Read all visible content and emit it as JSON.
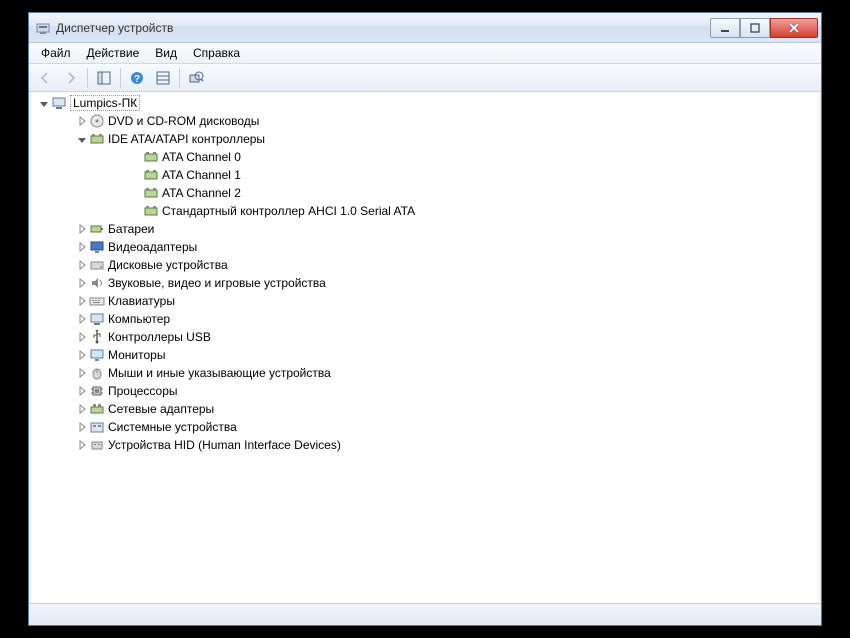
{
  "window": {
    "title": "Диспетчер устройств"
  },
  "menu": {
    "file": "Файл",
    "action": "Действие",
    "view": "Вид",
    "help": "Справка"
  },
  "tree": {
    "root": "Lumpics-ПК",
    "items": [
      {
        "label": "DVD и CD-ROM дисководы",
        "icon": "disc",
        "expanded": false,
        "children": []
      },
      {
        "label": "IDE ATA/ATAPI контроллеры",
        "icon": "controller",
        "expanded": true,
        "children": [
          {
            "label": "ATA Channel 0",
            "icon": "controller"
          },
          {
            "label": "ATA Channel 1",
            "icon": "controller"
          },
          {
            "label": "ATA Channel 2",
            "icon": "controller"
          },
          {
            "label": "Стандартный контроллер AHCI 1.0 Serial ATA",
            "icon": "controller"
          }
        ]
      },
      {
        "label": "Батареи",
        "icon": "battery",
        "expanded": false,
        "children": []
      },
      {
        "label": "Видеоадаптеры",
        "icon": "display",
        "expanded": false,
        "children": []
      },
      {
        "label": "Дисковые устройства",
        "icon": "drive",
        "expanded": false,
        "children": []
      },
      {
        "label": "Звуковые, видео и игровые устройства",
        "icon": "sound",
        "expanded": false,
        "children": []
      },
      {
        "label": "Клавиатуры",
        "icon": "keyboard",
        "expanded": false,
        "children": []
      },
      {
        "label": "Компьютер",
        "icon": "computer",
        "expanded": false,
        "children": []
      },
      {
        "label": "Контроллеры USB",
        "icon": "usb",
        "expanded": false,
        "children": []
      },
      {
        "label": "Мониторы",
        "icon": "monitor",
        "expanded": false,
        "children": []
      },
      {
        "label": "Мыши и иные указывающие устройства",
        "icon": "mouse",
        "expanded": false,
        "children": []
      },
      {
        "label": "Процессоры",
        "icon": "cpu",
        "expanded": false,
        "children": []
      },
      {
        "label": "Сетевые адаптеры",
        "icon": "network",
        "expanded": false,
        "children": []
      },
      {
        "label": "Системные устройства",
        "icon": "system",
        "expanded": false,
        "children": []
      },
      {
        "label": "Устройства HID (Human Interface Devices)",
        "icon": "hid",
        "expanded": false,
        "children": []
      }
    ]
  }
}
